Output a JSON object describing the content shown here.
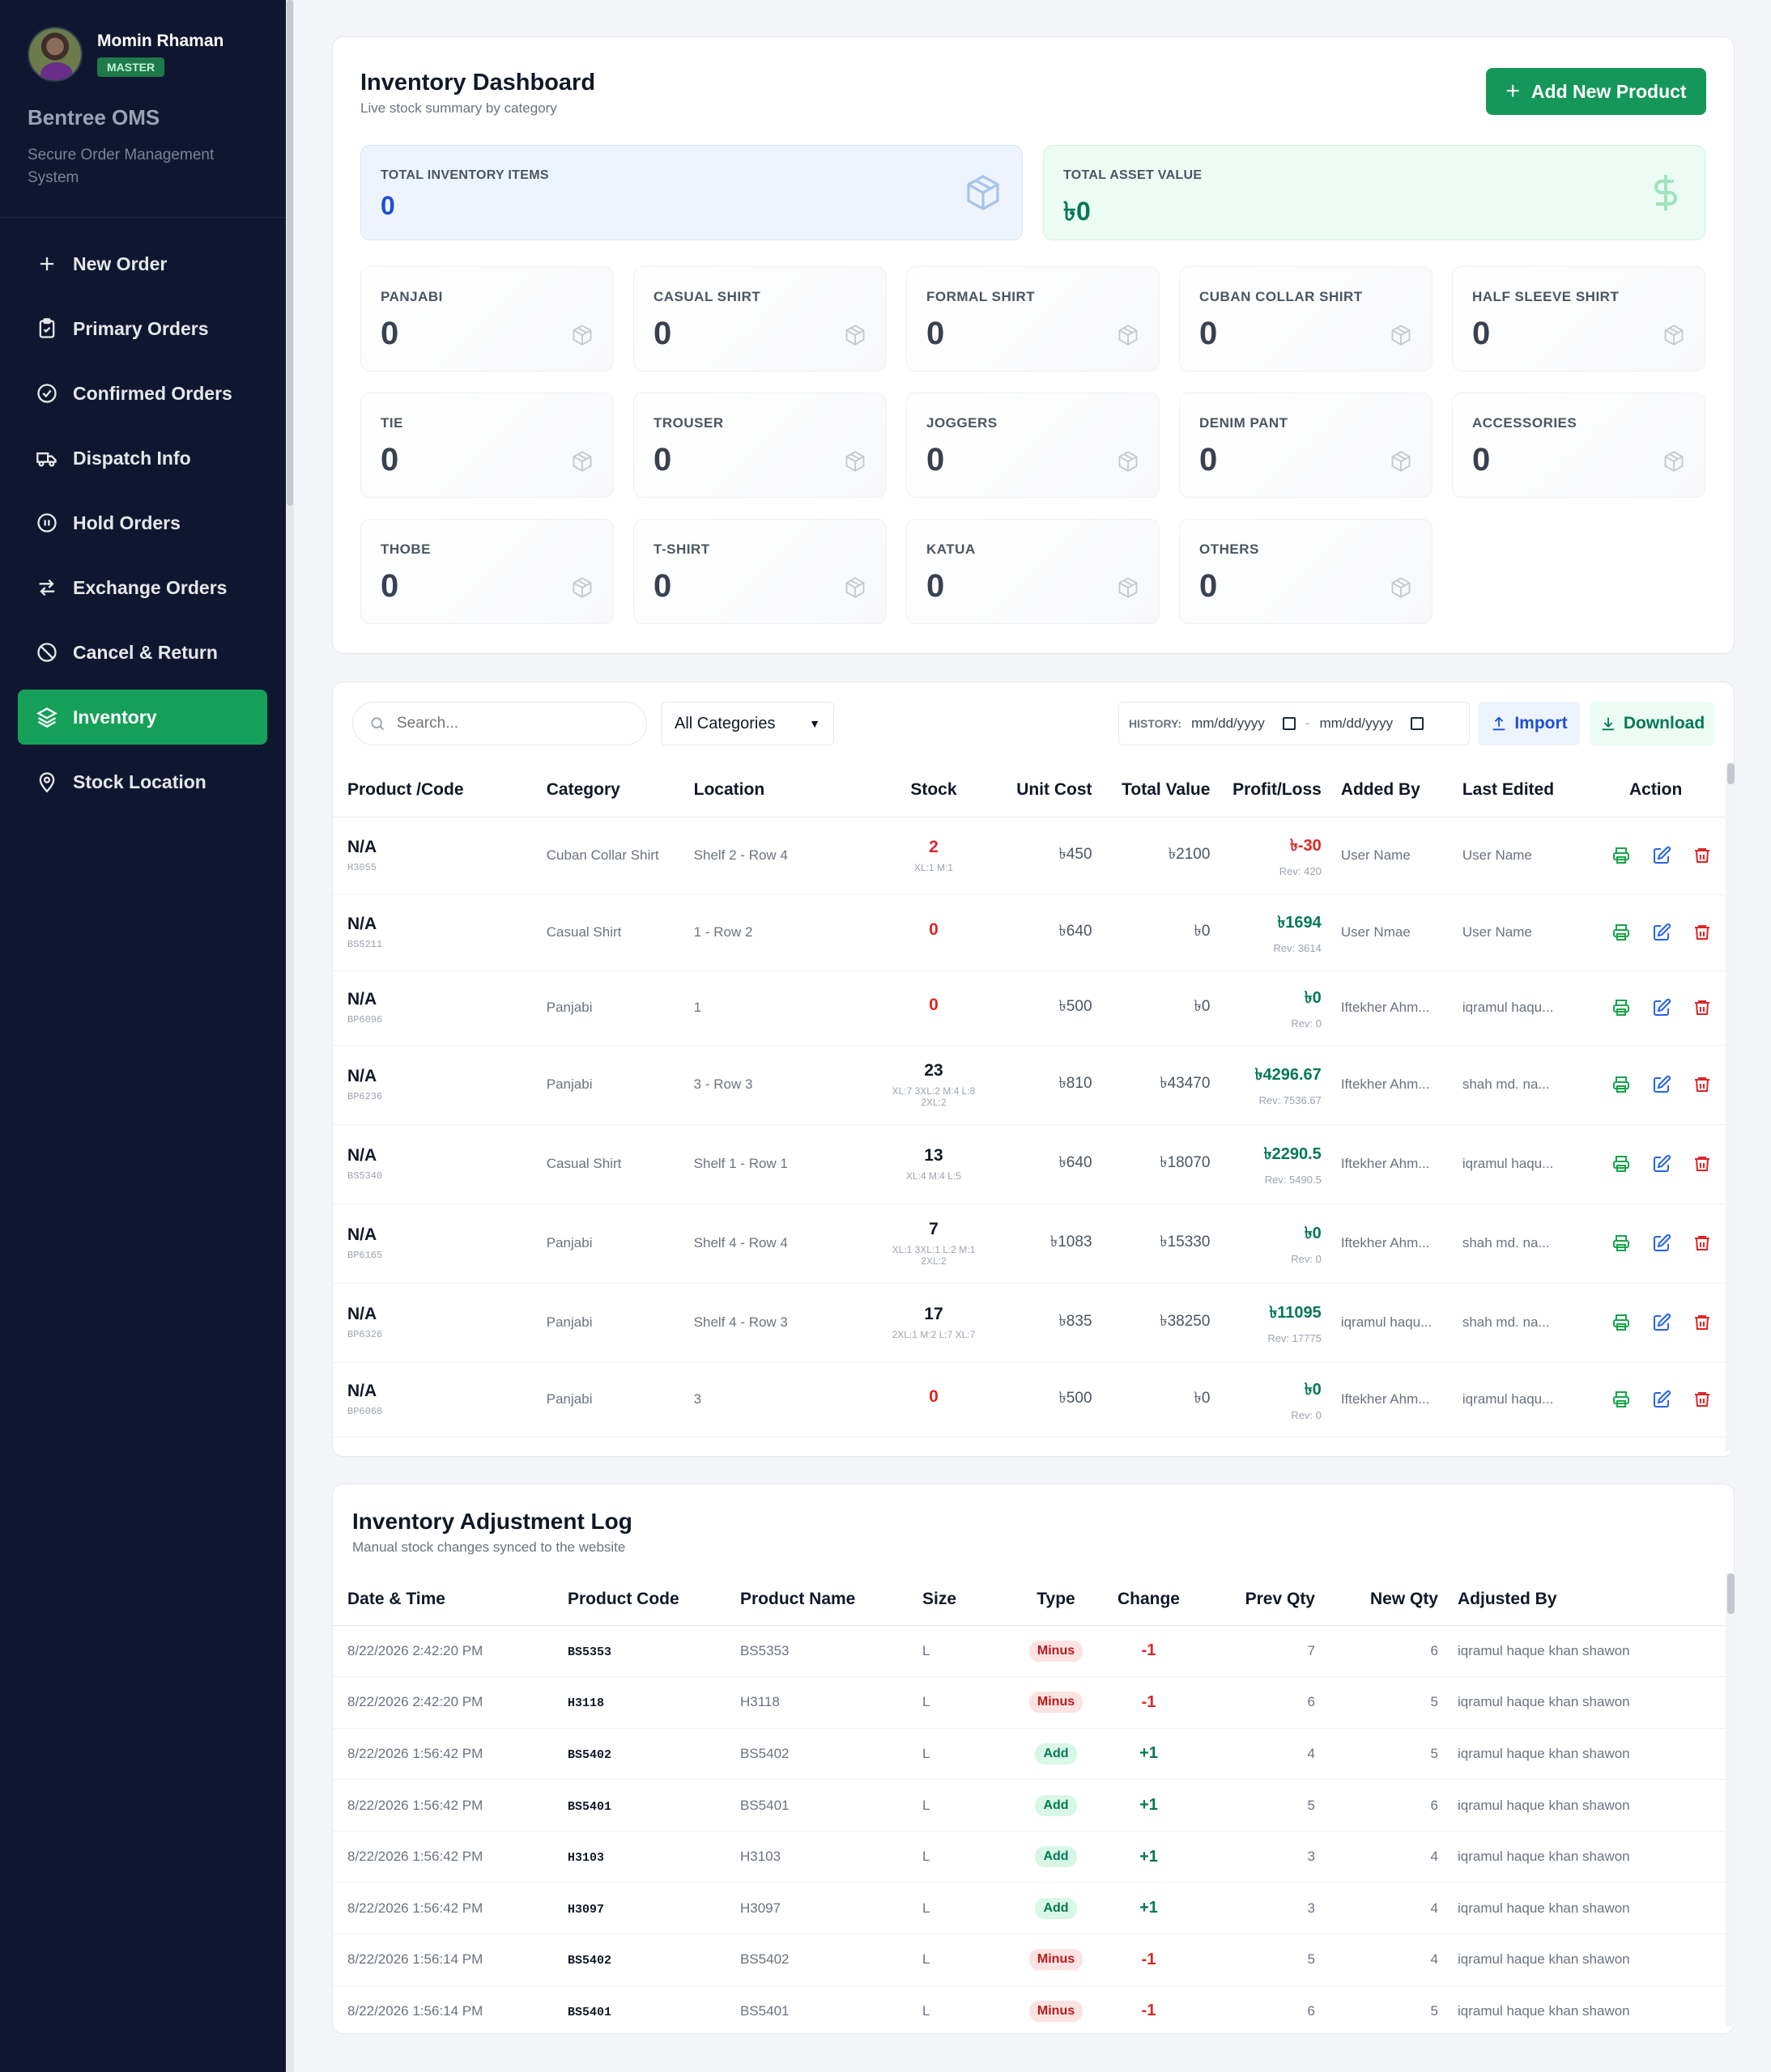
{
  "sidebar": {
    "user_name": "Momin Rhaman",
    "user_role": "MASTER",
    "brand": "Bentree OMS",
    "brand_sub": "Secure Order Management System",
    "items": [
      {
        "label": "New Order",
        "icon": "plus-icon"
      },
      {
        "label": "Primary Orders",
        "icon": "clipboard-icon"
      },
      {
        "label": "Confirmed Orders",
        "icon": "check-circle-icon"
      },
      {
        "label": "Dispatch Info",
        "icon": "truck-icon"
      },
      {
        "label": "Hold Orders",
        "icon": "pause-circle-icon"
      },
      {
        "label": "Exchange Orders",
        "icon": "swap-icon"
      },
      {
        "label": "Cancel & Return",
        "icon": "ban-icon"
      },
      {
        "label": "Inventory",
        "icon": "layers-icon",
        "active": true
      },
      {
        "label": "Stock Location",
        "icon": "map-pin-icon"
      }
    ]
  },
  "dashboard": {
    "title": "Inventory Dashboard",
    "subtitle": "Live stock summary by category",
    "add_button": "Add New Product",
    "total_items_label": "TOTAL INVENTORY ITEMS",
    "total_items_value": "0",
    "total_asset_label": "TOTAL ASSET VALUE",
    "total_asset_value": "৳0",
    "categories": [
      {
        "label": "PANJABI",
        "value": "0"
      },
      {
        "label": "CASUAL SHIRT",
        "value": "0"
      },
      {
        "label": "FORMAL SHIRT",
        "value": "0"
      },
      {
        "label": "CUBAN COLLAR SHIRT",
        "value": "0"
      },
      {
        "label": "HALF SLEEVE SHIRT",
        "value": "0"
      },
      {
        "label": "TIE",
        "value": "0"
      },
      {
        "label": "TROUSER",
        "value": "0"
      },
      {
        "label": "JOGGERS",
        "value": "0"
      },
      {
        "label": "DENIM PANT",
        "value": "0"
      },
      {
        "label": "ACCESSORIES",
        "value": "0"
      },
      {
        "label": "THOBE",
        "value": "0"
      },
      {
        "label": "T-SHIRT",
        "value": "0"
      },
      {
        "label": "KATUA",
        "value": "0"
      },
      {
        "label": "OTHERS",
        "value": "0"
      }
    ]
  },
  "inventory": {
    "search_placeholder": "Search...",
    "category_filter": "All Categories",
    "history_label": "HISTORY:",
    "date_from": "mm/dd/yyyy",
    "date_to": "mm/dd/yyyy",
    "date_sep": "-",
    "import_label": "Import",
    "download_label": "Download",
    "headers": [
      "Product /Code",
      "Category",
      "Location",
      "Stock",
      "Unit Cost",
      "Total Value",
      "Profit/Loss",
      "Added By",
      "Last Edited",
      "Action"
    ],
    "rows": [
      {
        "name": "N/A",
        "code": "H3055",
        "category": "Cuban Collar Shirt",
        "location": "Shelf 2 - Row 4",
        "stock": "2",
        "sizes": "XL:1 M:1",
        "unit_cost": "৳450",
        "total_value": "৳2100",
        "profit": "৳-30",
        "profit_sign": "neg",
        "rev": "Rev: 420",
        "added_by": "User Name",
        "last_edited": "User Name"
      },
      {
        "name": "N/A",
        "code": "BS5211",
        "category": "Casual Shirt",
        "location": "1 - Row 2",
        "stock": "0",
        "sizes": "",
        "unit_cost": "৳640",
        "total_value": "৳0",
        "profit": "৳1694",
        "profit_sign": "pos",
        "rev": "Rev: 3614",
        "added_by": "User Nmae",
        "last_edited": "User Name"
      },
      {
        "name": "N/A",
        "code": "BP6096",
        "category": "Panjabi",
        "location": "1",
        "stock": "0",
        "sizes": "",
        "unit_cost": "৳500",
        "total_value": "৳0",
        "profit": "৳0",
        "profit_sign": "pos",
        "rev": "Rev: 0",
        "added_by": "Iftekher Ahm...",
        "last_edited": "iqramul haqu..."
      },
      {
        "name": "N/A",
        "code": "BP6236",
        "category": "Panjabi",
        "location": "3 - Row 3",
        "stock": "23",
        "sizes": "XL:7 3XL:2 M:4 L:8 2XL:2",
        "unit_cost": "৳810",
        "total_value": "৳43470",
        "profit": "৳4296.67",
        "profit_sign": "pos",
        "rev": "Rev: 7536.67",
        "added_by": "Iftekher Ahm...",
        "last_edited": "shah md. na..."
      },
      {
        "name": "N/A",
        "code": "BS5340",
        "category": "Casual Shirt",
        "location": "Shelf 1 - Row 1",
        "stock": "13",
        "sizes": "XL:4 M:4 L:5",
        "unit_cost": "৳640",
        "total_value": "৳18070",
        "profit": "৳2290.5",
        "profit_sign": "pos",
        "rev": "Rev: 5490.5",
        "added_by": "Iftekher Ahm...",
        "last_edited": "iqramul haqu..."
      },
      {
        "name": "N/A",
        "code": "BP6165",
        "category": "Panjabi",
        "location": "Shelf 4 - Row 4",
        "stock": "7",
        "sizes": "XL:1 3XL:1 L:2 M:1 2XL:2",
        "unit_cost": "৳1083",
        "total_value": "৳15330",
        "profit": "৳0",
        "profit_sign": "pos",
        "rev": "Rev: 0",
        "added_by": "Iftekher Ahm...",
        "last_edited": "shah md. na..."
      },
      {
        "name": "N/A",
        "code": "BP6326",
        "category": "Panjabi",
        "location": "Shelf 4 - Row 3",
        "stock": "17",
        "sizes": "2XL:1 M:2 L:7 XL:7",
        "unit_cost": "৳835",
        "total_value": "৳38250",
        "profit": "৳11095",
        "profit_sign": "pos",
        "rev": "Rev: 17775",
        "added_by": "iqramul haqu...",
        "last_edited": "shah md. na..."
      },
      {
        "name": "N/A",
        "code": "BP6068",
        "category": "Panjabi",
        "location": "3",
        "stock": "0",
        "sizes": "",
        "unit_cost": "৳500",
        "total_value": "৳0",
        "profit": "৳0",
        "profit_sign": "pos",
        "rev": "Rev: 0",
        "added_by": "Iftekher Ahm...",
        "last_edited": "iqramul haqu..."
      }
    ]
  },
  "log": {
    "title": "Inventory Adjustment Log",
    "subtitle": "Manual stock changes synced to the website",
    "headers": [
      "Date & Time",
      "Product Code",
      "Product Name",
      "Size",
      "Type",
      "Change",
      "Prev Qty",
      "New Qty",
      "Adjusted By"
    ],
    "rows": [
      {
        "date": "8/22/2026 2:42:20 PM",
        "code": "BS5353",
        "name": "BS5353",
        "size": "L",
        "type": "Minus",
        "change": "-1",
        "prev": "7",
        "new": "6",
        "by": "iqramul haque khan shawon"
      },
      {
        "date": "8/22/2026 2:42:20 PM",
        "code": "H3118",
        "name": "H3118",
        "size": "L",
        "type": "Minus",
        "change": "-1",
        "prev": "6",
        "new": "5",
        "by": "iqramul haque khan shawon"
      },
      {
        "date": "8/22/2026 1:56:42 PM",
        "code": "BS5402",
        "name": "BS5402",
        "size": "L",
        "type": "Add",
        "change": "+1",
        "prev": "4",
        "new": "5",
        "by": "iqramul haque khan shawon"
      },
      {
        "date": "8/22/2026 1:56:42 PM",
        "code": "BS5401",
        "name": "BS5401",
        "size": "L",
        "type": "Add",
        "change": "+1",
        "prev": "5",
        "new": "6",
        "by": "iqramul haque khan shawon"
      },
      {
        "date": "8/22/2026 1:56:42 PM",
        "code": "H3103",
        "name": "H3103",
        "size": "L",
        "type": "Add",
        "change": "+1",
        "prev": "3",
        "new": "4",
        "by": "iqramul haque khan shawon"
      },
      {
        "date": "8/22/2026 1:56:42 PM",
        "code": "H3097",
        "name": "H3097",
        "size": "L",
        "type": "Add",
        "change": "+1",
        "prev": "3",
        "new": "4",
        "by": "iqramul haque khan shawon"
      },
      {
        "date": "8/22/2026 1:56:14 PM",
        "code": "BS5402",
        "name": "BS5402",
        "size": "L",
        "type": "Minus",
        "change": "-1",
        "prev": "5",
        "new": "4",
        "by": "iqramul haque khan shawon"
      },
      {
        "date": "8/22/2026 1:56:14 PM",
        "code": "BS5401",
        "name": "BS5401",
        "size": "L",
        "type": "Minus",
        "change": "-1",
        "prev": "6",
        "new": "5",
        "by": "iqramul haque khan shawon"
      }
    ]
  },
  "colors": {
    "accent": "#15a05a",
    "sidebar_bg": "#0f1730",
    "danger": "#dc2626",
    "primary": "#1d4ed8"
  }
}
